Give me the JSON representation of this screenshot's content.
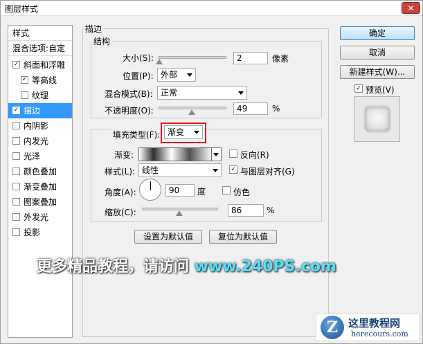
{
  "window": {
    "title": "图层样式",
    "close": "×"
  },
  "left_panel": {
    "header": "样式",
    "blend": "混合选项:自定",
    "items": [
      {
        "label": "斜面和浮雕",
        "checked": true
      },
      {
        "label": "等高线",
        "checked": true
      },
      {
        "label": "纹理",
        "checked": false
      },
      {
        "label": "描边",
        "checked": true
      },
      {
        "label": "内阴影",
        "checked": false
      },
      {
        "label": "内发光",
        "checked": false
      },
      {
        "label": "光泽",
        "checked": false
      },
      {
        "label": "颜色叠加",
        "checked": false
      },
      {
        "label": "渐变叠加",
        "checked": false
      },
      {
        "label": "图案叠加",
        "checked": false
      },
      {
        "label": "外发光",
        "checked": false
      },
      {
        "label": "投影",
        "checked": false
      }
    ]
  },
  "stroke": {
    "section_title": "描边",
    "structure_title": "结构",
    "size_label": "大小(S):",
    "size_value": "2",
    "size_unit": "像素",
    "position_label": "位置(P):",
    "position_value": "外部",
    "blend_label": "混合模式(B):",
    "blend_value": "正常",
    "opacity_label": "不透明度(O):",
    "opacity_value": "49",
    "opacity_unit": "%",
    "fill_type_label": "填充类型(F):",
    "fill_type_value": "渐变",
    "gradient_label": "渐变:",
    "reverse_label": "反向(R)",
    "style_label": "样式(L):",
    "style_value": "线性",
    "align_label": "与图层对齐(G)",
    "angle_label": "角度(A):",
    "angle_value": "90",
    "angle_unit": "度",
    "dither_label": "仿色",
    "scale_label": "缩放(C):",
    "scale_value": "86",
    "scale_unit": "%",
    "set_default": "设置为默认值",
    "reset_default": "复位为默认值"
  },
  "right": {
    "ok": "确定",
    "cancel": "取消",
    "new_style": "新建样式(W)...",
    "preview_label": "预览(V)",
    "preview_checked": true
  },
  "watermark": {
    "text": "更多精品教程，请访问 ",
    "url": "www.240PS.com"
  },
  "logo": {
    "letter": "Z",
    "cn": "这里教程网",
    "en": "herecours.com"
  },
  "colors": {
    "selected": "#3399ff",
    "highlight_box": "#d21f1f"
  }
}
